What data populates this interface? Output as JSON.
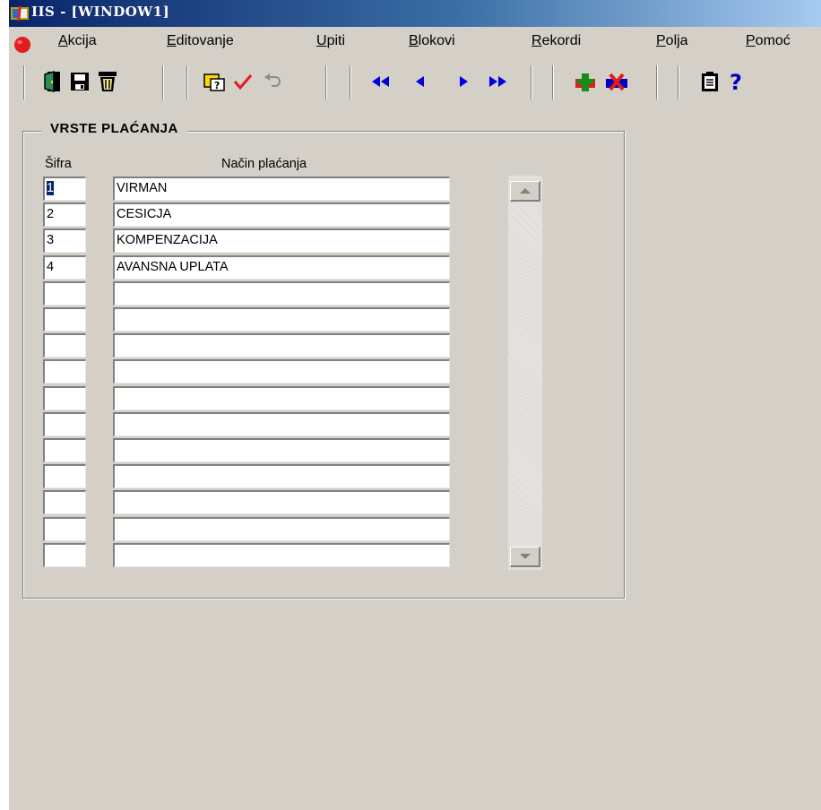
{
  "window": {
    "title": "IIS  - [WINDOW1]"
  },
  "menu": {
    "items": [
      "Akcija",
      "Editovanje",
      "Upiti",
      "Blokovi",
      "Rekordi",
      "Polja",
      "Pomoć"
    ]
  },
  "toolbar": {
    "buttons": [
      "exit-icon",
      "save-icon",
      "trash-icon",
      "query-icon",
      "check-icon",
      "undo-icon",
      "first-record-icon",
      "previous-record-icon",
      "next-record-icon",
      "last-record-icon",
      "insert-record-icon",
      "delete-record-icon",
      "clipboard-icon",
      "help-icon"
    ]
  },
  "form": {
    "group_title": "VRSTE PLAĆANJA",
    "columns": {
      "code": "Šifra",
      "name": "Način plaćanja"
    },
    "rows": [
      {
        "code": "1",
        "name": "VIRMAN"
      },
      {
        "code": "2",
        "name": "CESICJA"
      },
      {
        "code": "3",
        "name": "KOMPENZACIJA"
      },
      {
        "code": "4",
        "name": "AVANSNA UPLATA"
      },
      {
        "code": "",
        "name": ""
      },
      {
        "code": "",
        "name": ""
      },
      {
        "code": "",
        "name": ""
      },
      {
        "code": "",
        "name": ""
      },
      {
        "code": "",
        "name": ""
      },
      {
        "code": "",
        "name": ""
      },
      {
        "code": "",
        "name": ""
      },
      {
        "code": "",
        "name": ""
      },
      {
        "code": "",
        "name": ""
      },
      {
        "code": "",
        "name": ""
      },
      {
        "code": "",
        "name": ""
      }
    ]
  },
  "colors": {
    "titlebar": "#0a246a",
    "face": "#d4d0c8",
    "selection": "#0a246a"
  }
}
